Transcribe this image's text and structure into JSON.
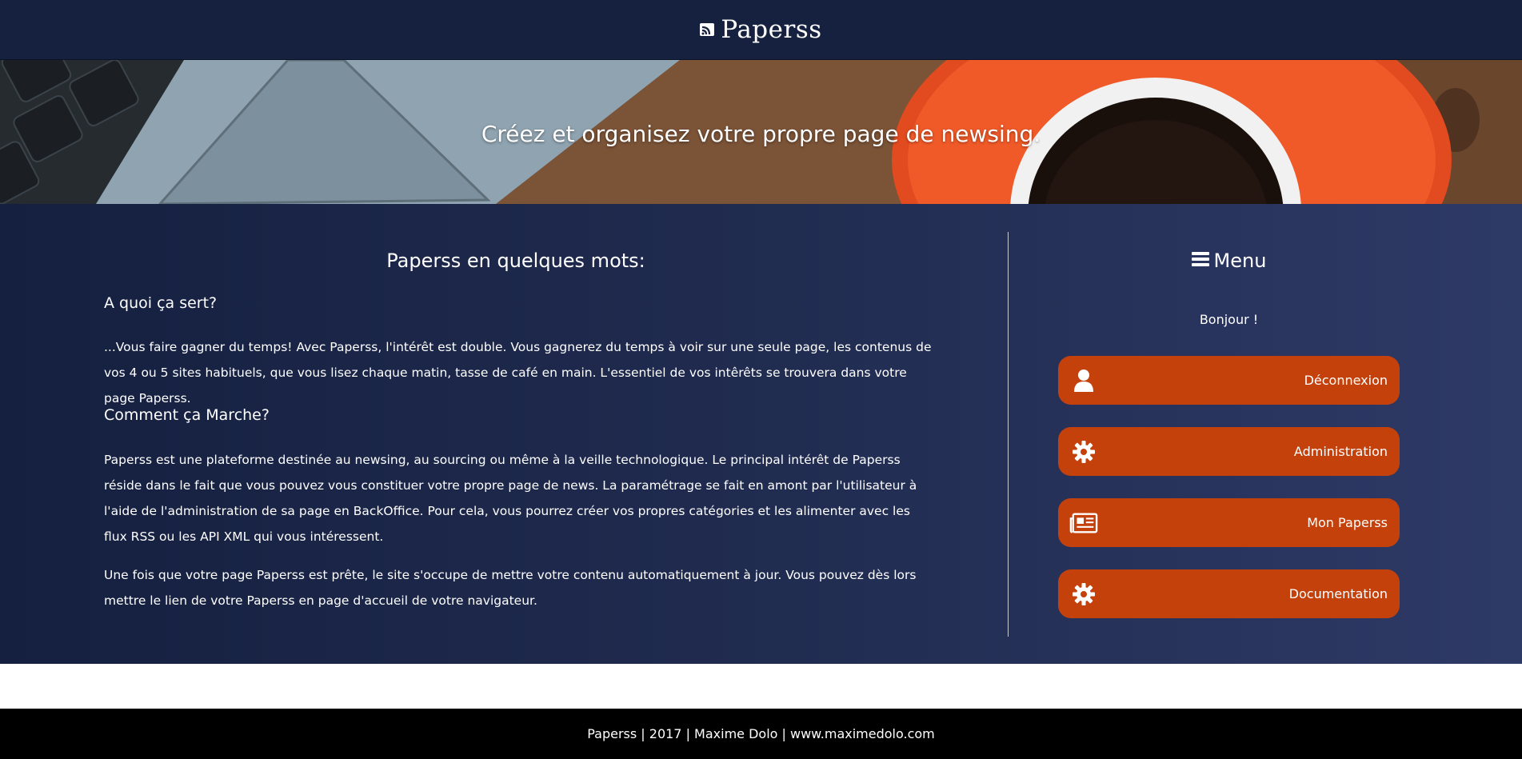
{
  "header": {
    "brand_icon": "rss-icon",
    "title": "Paperss"
  },
  "hero": {
    "tagline": "Créez et organisez votre propre page de newsing."
  },
  "content": {
    "heading": "Paperss en quelques mots:",
    "section1_title": "A quoi ça sert?",
    "section1_text": "...Vous faire gagner du temps! Avec Paperss, l'intérêt est double. Vous gagnerez du temps à voir sur une seule page, les contenus de vos 4 ou 5 sites habituels, que vous lisez chaque matin, tasse de café en main. L'essentiel de vos intêrêts se trouvera dans votre page Paperss.",
    "section2_title": "Comment ça Marche?",
    "section2_text1": "Paperss est une plateforme destinée au newsing, au sourcing ou même à la veille technologique. Le principal intérêt de Paperss réside dans le fait que vous pouvez vous constituer votre propre page de news. La paramétrage se fait en amont par l'utilisateur à l'aide de l'administration de sa page en BackOffice. Pour cela, vous pourrez créer vos propres catégories et les alimenter avec les flux RSS ou les API XML qui vous intéressent.",
    "section2_text2": "Une fois que votre page Paperss est prête, le site s'occupe de mettre votre contenu automatiquement à jour. Vous pouvez dès lors mettre le lien de votre Paperss en page d'accueil de votre navigateur."
  },
  "menu": {
    "title": "Menu",
    "title_icon": "bars-icon",
    "greeting": "Bonjour !",
    "items": [
      {
        "label": "Déconnexion",
        "icon": "user-icon"
      },
      {
        "label": "Administration",
        "icon": "gear-icon"
      },
      {
        "label": "Mon Paperss",
        "icon": "newspaper-icon"
      },
      {
        "label": "Documentation",
        "icon": "gear-icon"
      }
    ]
  },
  "footer": {
    "text": "Paperss | 2017 | Maxime Dolo | www.maximedolo.com"
  },
  "colors": {
    "header_bg": "#15213f",
    "main_bg_start": "#152040",
    "main_bg_end": "#2e3a66",
    "button_bg": "#c5410c",
    "footer_bg": "#000000"
  }
}
